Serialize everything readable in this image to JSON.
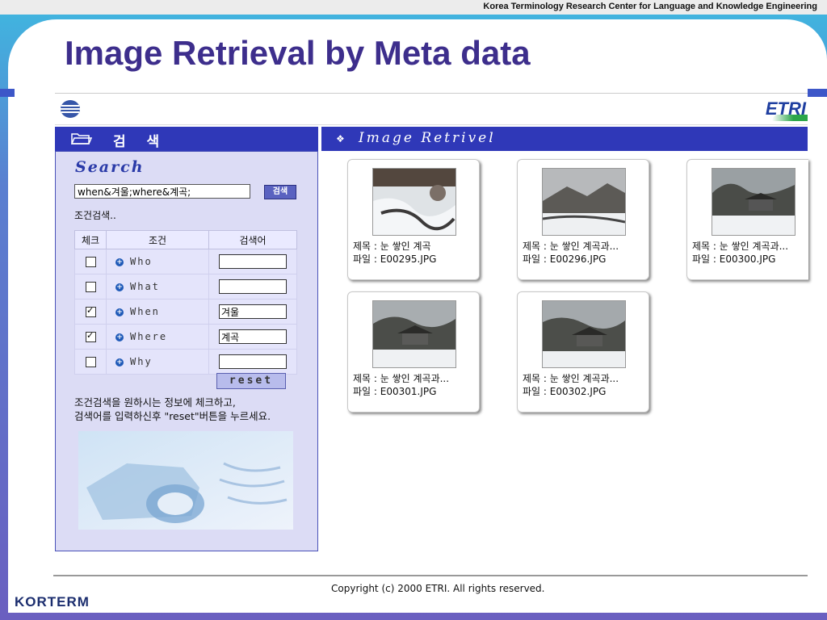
{
  "header": {
    "organization": "Korea Terminology Research Center for Language and Knowledge Engineering"
  },
  "slide": {
    "title": "Image Retrieval by Meta data",
    "corner_logo": "KORTERM"
  },
  "app": {
    "logo_text": "ETRI",
    "search_tab_label": "검 색",
    "results_tab_label": "Image Retrivel",
    "search_heading": "Search",
    "query_value": "when&겨울;where&계곡;",
    "search_button_label": "검색",
    "conditional_search_label": "조건검색..",
    "table_headers": [
      "체크",
      "조건",
      "검색어"
    ],
    "conditions": [
      {
        "name": "Who",
        "checked": false,
        "term": ""
      },
      {
        "name": "What",
        "checked": false,
        "term": ""
      },
      {
        "name": "When",
        "checked": true,
        "term": "겨울"
      },
      {
        "name": "Where",
        "checked": true,
        "term": "계곡"
      },
      {
        "name": "Why",
        "checked": false,
        "term": ""
      }
    ],
    "reset_label": "reset",
    "help_line1": "조건검색을 원하시는 정보에 체크하고,",
    "help_line2": "검색어를 입력하신후 \"reset\"버튼을 누르세요.",
    "results": [
      {
        "title": "제목 : 눈 쌓인 계곡",
        "file": "파일 : E00295.JPG"
      },
      {
        "title": "제목 : 눈 쌓인 계곡과...",
        "file": "파일 : E00296.JPG"
      },
      {
        "title": "제목 : 눈 쌓인 계곡과...",
        "file": "파일 : E00300.JPG"
      },
      {
        "title": "제목 : 눈 쌓인 계곡과...",
        "file": "파일 : E00301.JPG"
      },
      {
        "title": "제목 : 눈 쌓인 계곡과...",
        "file": "파일 : E00302.JPG"
      }
    ],
    "copyright": "Copyright (c) 2000  ETRI. All rights reserved."
  },
  "colors": {
    "title": "#3d2e8c",
    "tab_bar": "#2f38b8",
    "panel": "#dcdcf5"
  }
}
